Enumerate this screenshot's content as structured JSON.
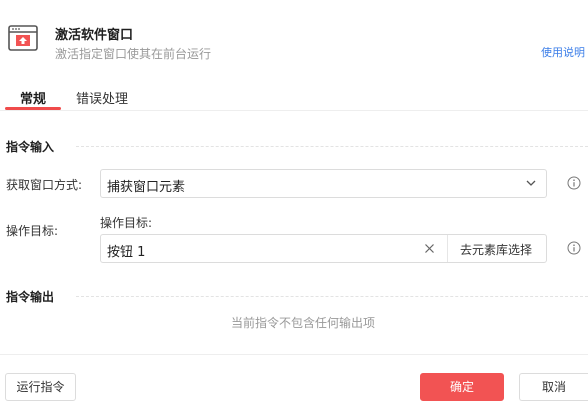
{
  "header": {
    "icon": "window-activate-icon",
    "title": "激活软件窗口",
    "subtitle": "激活指定窗口使其在前台运行",
    "help_link": "使用说明"
  },
  "tabs": [
    {
      "label": "常规",
      "active": true
    },
    {
      "label": "错误处理",
      "active": false
    }
  ],
  "input_section": {
    "title": "指令输入",
    "window_method": {
      "label": "获取窗口方式:",
      "value": "捕获窗口元素"
    },
    "target": {
      "label": "操作目标:",
      "sublabel": "操作目标:",
      "value": "按钮 1",
      "pick_button": "去元素库选择"
    }
  },
  "output_section": {
    "title": "指令输出",
    "empty_text": "当前指令不包含任何输出项"
  },
  "footer": {
    "run_button": "运行指令",
    "confirm_button": "确定",
    "cancel_button": "取消"
  },
  "colors": {
    "accent": "#f25353",
    "link": "#3b7ee8"
  }
}
